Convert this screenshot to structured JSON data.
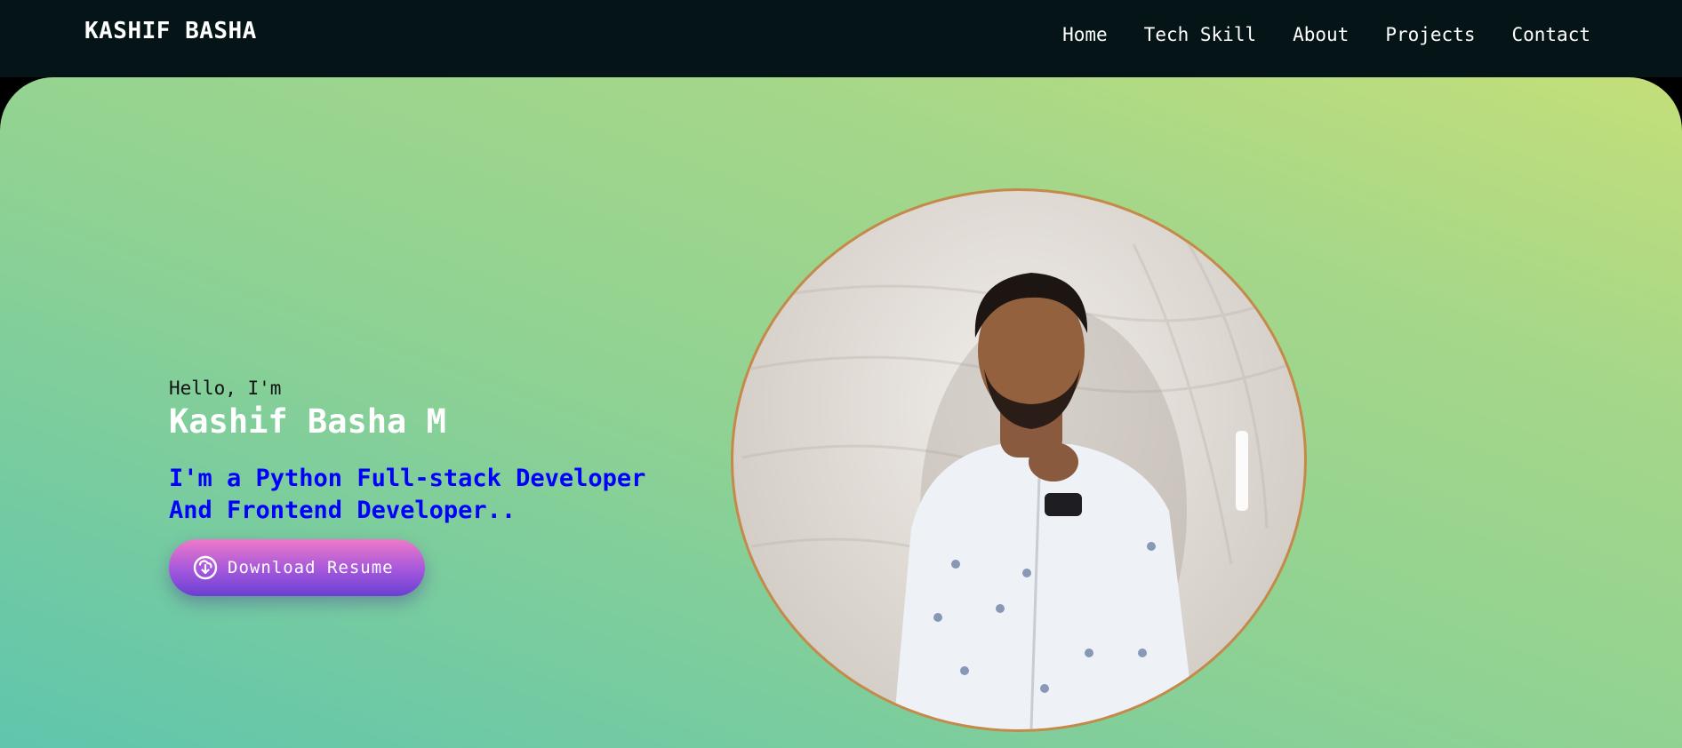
{
  "navbar": {
    "brand": "KASHIF BASHA",
    "links": [
      {
        "label": "Home"
      },
      {
        "label": "Tech Skill"
      },
      {
        "label": "About"
      },
      {
        "label": "Projects"
      },
      {
        "label": "Contact"
      }
    ]
  },
  "hero": {
    "greeting": "Hello, I'm",
    "name": "Kashif Basha M",
    "tagline_line1": "I'm a Python Full-stack Developer",
    "tagline_line2": "And Frontend Developer..",
    "download_button": {
      "label": "Download Resume",
      "icon": "cloud-download-icon"
    },
    "profile_photo": {
      "icon": "profile-photo"
    }
  },
  "colors": {
    "navbar_bg": "#051416",
    "tagline": "#0000ff",
    "button_top": "#ef79c8",
    "button_bottom": "#6a3fd2",
    "photo_border": "#c48a4a"
  }
}
